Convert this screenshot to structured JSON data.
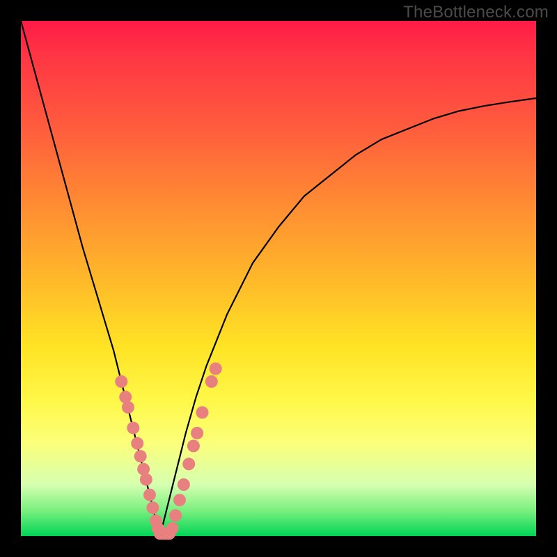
{
  "watermark": "TheBottleneck.com",
  "colors": {
    "frame": "#000000",
    "curve": "#000000",
    "marker_fill": "#e98080",
    "marker_stroke": "#d86e6e"
  },
  "chart_data": {
    "type": "line",
    "title": "",
    "xlabel": "",
    "ylabel": "",
    "xlim": [
      0,
      100
    ],
    "ylim": [
      0,
      100
    ],
    "grid": false,
    "legend": false,
    "note": "V-shaped bottleneck curve; y is percent bottleneck, minimum near x≈27",
    "series": [
      {
        "name": "bottleneck-curve",
        "x": [
          0,
          3,
          6,
          9,
          12,
          15,
          18,
          20,
          22,
          24,
          26,
          27,
          28,
          30,
          32,
          34,
          36,
          40,
          45,
          50,
          55,
          60,
          65,
          70,
          75,
          80,
          85,
          90,
          95,
          100
        ],
        "y": [
          100,
          89,
          78,
          67,
          56,
          46,
          36,
          28,
          20,
          12,
          4,
          0,
          4,
          12,
          20,
          27,
          33,
          43,
          53,
          60,
          66,
          70,
          74,
          77,
          79,
          81,
          82.5,
          83.5,
          84.3,
          85
        ]
      }
    ],
    "markers": {
      "name": "highlighted-points",
      "note": "salmon dots clustered near the minimum of the V",
      "points": [
        {
          "x": 19.5,
          "y": 30
        },
        {
          "x": 20.3,
          "y": 27
        },
        {
          "x": 20.8,
          "y": 25
        },
        {
          "x": 21.8,
          "y": 21
        },
        {
          "x": 22.6,
          "y": 18
        },
        {
          "x": 23.2,
          "y": 15.5
        },
        {
          "x": 23.8,
          "y": 13
        },
        {
          "x": 24.3,
          "y": 11
        },
        {
          "x": 25.0,
          "y": 8
        },
        {
          "x": 25.6,
          "y": 5.5
        },
        {
          "x": 26.2,
          "y": 3
        },
        {
          "x": 26.6,
          "y": 1.5
        },
        {
          "x": 27.0,
          "y": 0.5
        },
        {
          "x": 27.6,
          "y": 0.5
        },
        {
          "x": 28.2,
          "y": 0.5
        },
        {
          "x": 28.8,
          "y": 0.5
        },
        {
          "x": 29.4,
          "y": 1.5
        },
        {
          "x": 30.0,
          "y": 4
        },
        {
          "x": 30.8,
          "y": 7
        },
        {
          "x": 31.6,
          "y": 10
        },
        {
          "x": 32.6,
          "y": 14
        },
        {
          "x": 33.5,
          "y": 17.5
        },
        {
          "x": 34.2,
          "y": 20
        },
        {
          "x": 35.2,
          "y": 24
        },
        {
          "x": 37.0,
          "y": 30
        },
        {
          "x": 37.8,
          "y": 32.5
        }
      ]
    }
  }
}
